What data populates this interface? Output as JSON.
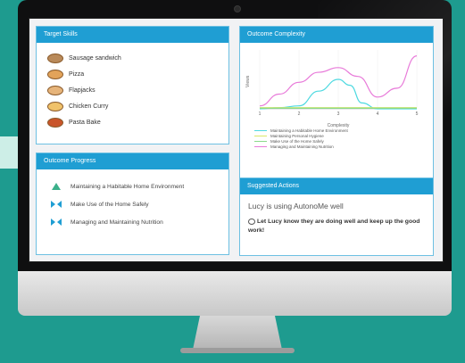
{
  "colors": {
    "background": "#1e9b8f",
    "header": "#1f9ed3",
    "card_border": "#6dc0e2"
  },
  "target_skills": {
    "title": "Target Skills",
    "items": [
      {
        "label": "Sausage sandwich",
        "icon": "sandwich-icon",
        "color": "#b98a5a"
      },
      {
        "label": "Pizza",
        "icon": "pizza-icon",
        "color": "#e2a35a"
      },
      {
        "label": "Flapjacks",
        "icon": "flapjack-icon",
        "color": "#e6b47a"
      },
      {
        "label": "Chicken Curry",
        "icon": "curry-icon",
        "color": "#f0c26a"
      },
      {
        "label": "Pasta Bake",
        "icon": "pasta-icon",
        "color": "#c9552b"
      }
    ]
  },
  "outcome_progress": {
    "title": "Outcome Progress",
    "items": [
      {
        "label": "Maintaining a Habitable Home Environment",
        "icon": "triangle-up-icon"
      },
      {
        "label": "Make Use of the Home Safely",
        "icon": "bowtie-icon"
      },
      {
        "label": "Managing and Maintaining Nutrition",
        "icon": "bowtie-icon"
      }
    ]
  },
  "outcome_complexity": {
    "title": "Outcome Complexity"
  },
  "chart_data": {
    "type": "line",
    "xlabel": "Complexity",
    "ylabel": "Views",
    "xlim": [
      1,
      5
    ],
    "x_ticks": [
      "1",
      "2",
      "3",
      "4",
      "5"
    ],
    "series": [
      {
        "name": "Maintaining a Habitable Home Environment",
        "color": "#4dd9e0",
        "x": [
          1,
          1.5,
          2,
          2.5,
          3,
          3.3,
          3.6,
          4,
          4.5,
          5
        ],
        "y": [
          0,
          0.02,
          0.05,
          0.3,
          0.5,
          0.4,
          0.1,
          0,
          0,
          0
        ]
      },
      {
        "name": "Maintaining Personal Hygiene",
        "color": "#d9e86a",
        "x": [
          1,
          2,
          3,
          4,
          5
        ],
        "y": [
          0.02,
          0.02,
          0.02,
          0.02,
          0.02
        ]
      },
      {
        "name": "Make Use of the Home Safely",
        "color": "#8bd98b",
        "x": [
          1,
          2,
          3,
          4,
          5
        ],
        "y": [
          0.01,
          0.01,
          0.01,
          0.01,
          0.01
        ]
      },
      {
        "name": "Managing and Maintaining Nutrition",
        "color": "#e87ad9",
        "x": [
          1,
          1.5,
          2,
          2.5,
          3,
          3.5,
          4,
          4.5,
          5
        ],
        "y": [
          0.05,
          0.25,
          0.45,
          0.62,
          0.7,
          0.55,
          0.2,
          0.35,
          0.9
        ]
      }
    ]
  },
  "suggested_actions": {
    "title": "Suggested Actions",
    "main": "Lucy is using AutonoMe well",
    "sub": "Let Lucy know they are doing well and keep up the good work!"
  }
}
